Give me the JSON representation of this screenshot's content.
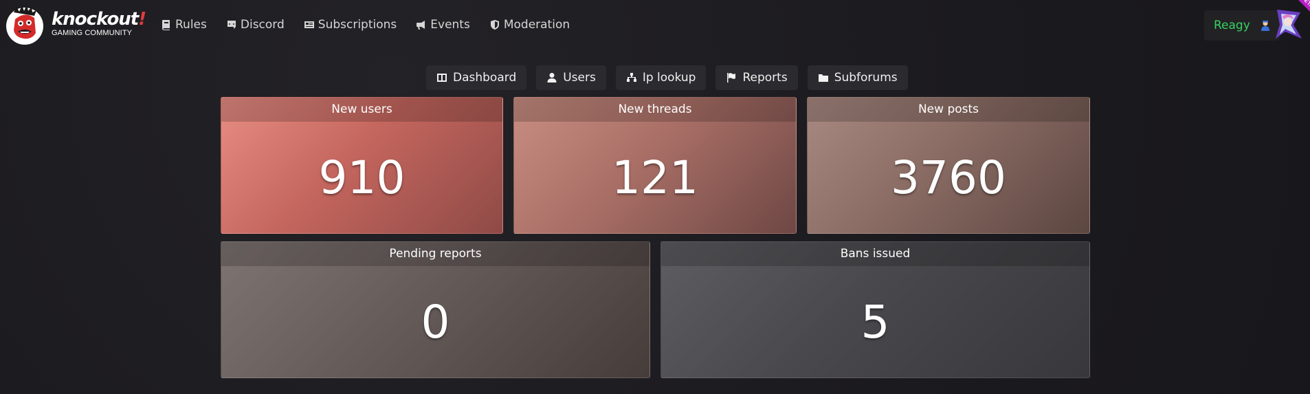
{
  "brand": {
    "title_main": "knockout",
    "title_bang": "!",
    "subtitle": "GAMING COMMUNITY"
  },
  "nav": {
    "items": [
      {
        "label": "Rules",
        "icon": "book-icon"
      },
      {
        "label": "Discord",
        "icon": "discord-icon"
      },
      {
        "label": "Subscriptions",
        "icon": "newspaper-icon"
      },
      {
        "label": "Events",
        "icon": "megaphone-icon"
      },
      {
        "label": "Moderation",
        "icon": "shield-icon"
      }
    ]
  },
  "user": {
    "name": "Reagy",
    "badge_icon": "moderator-badge-icon",
    "beta_label": "BETA"
  },
  "tabs": [
    {
      "label": "Dashboard",
      "icon": "columns-icon"
    },
    {
      "label": "Users",
      "icon": "user-icon"
    },
    {
      "label": "Ip lookup",
      "icon": "network-icon"
    },
    {
      "label": "Reports",
      "icon": "flag-icon"
    },
    {
      "label": "Subforums",
      "icon": "folder-icon"
    }
  ],
  "stats": [
    {
      "label": "New users",
      "value": "910"
    },
    {
      "label": "New threads",
      "value": "121"
    },
    {
      "label": "New posts",
      "value": "3760"
    },
    {
      "label": "Pending reports",
      "value": "0"
    },
    {
      "label": "Bans issued",
      "value": "5"
    }
  ],
  "colors": {
    "username": "#37d35e",
    "background": "#1c1b1f",
    "tab_background": "#2b2a2e"
  }
}
